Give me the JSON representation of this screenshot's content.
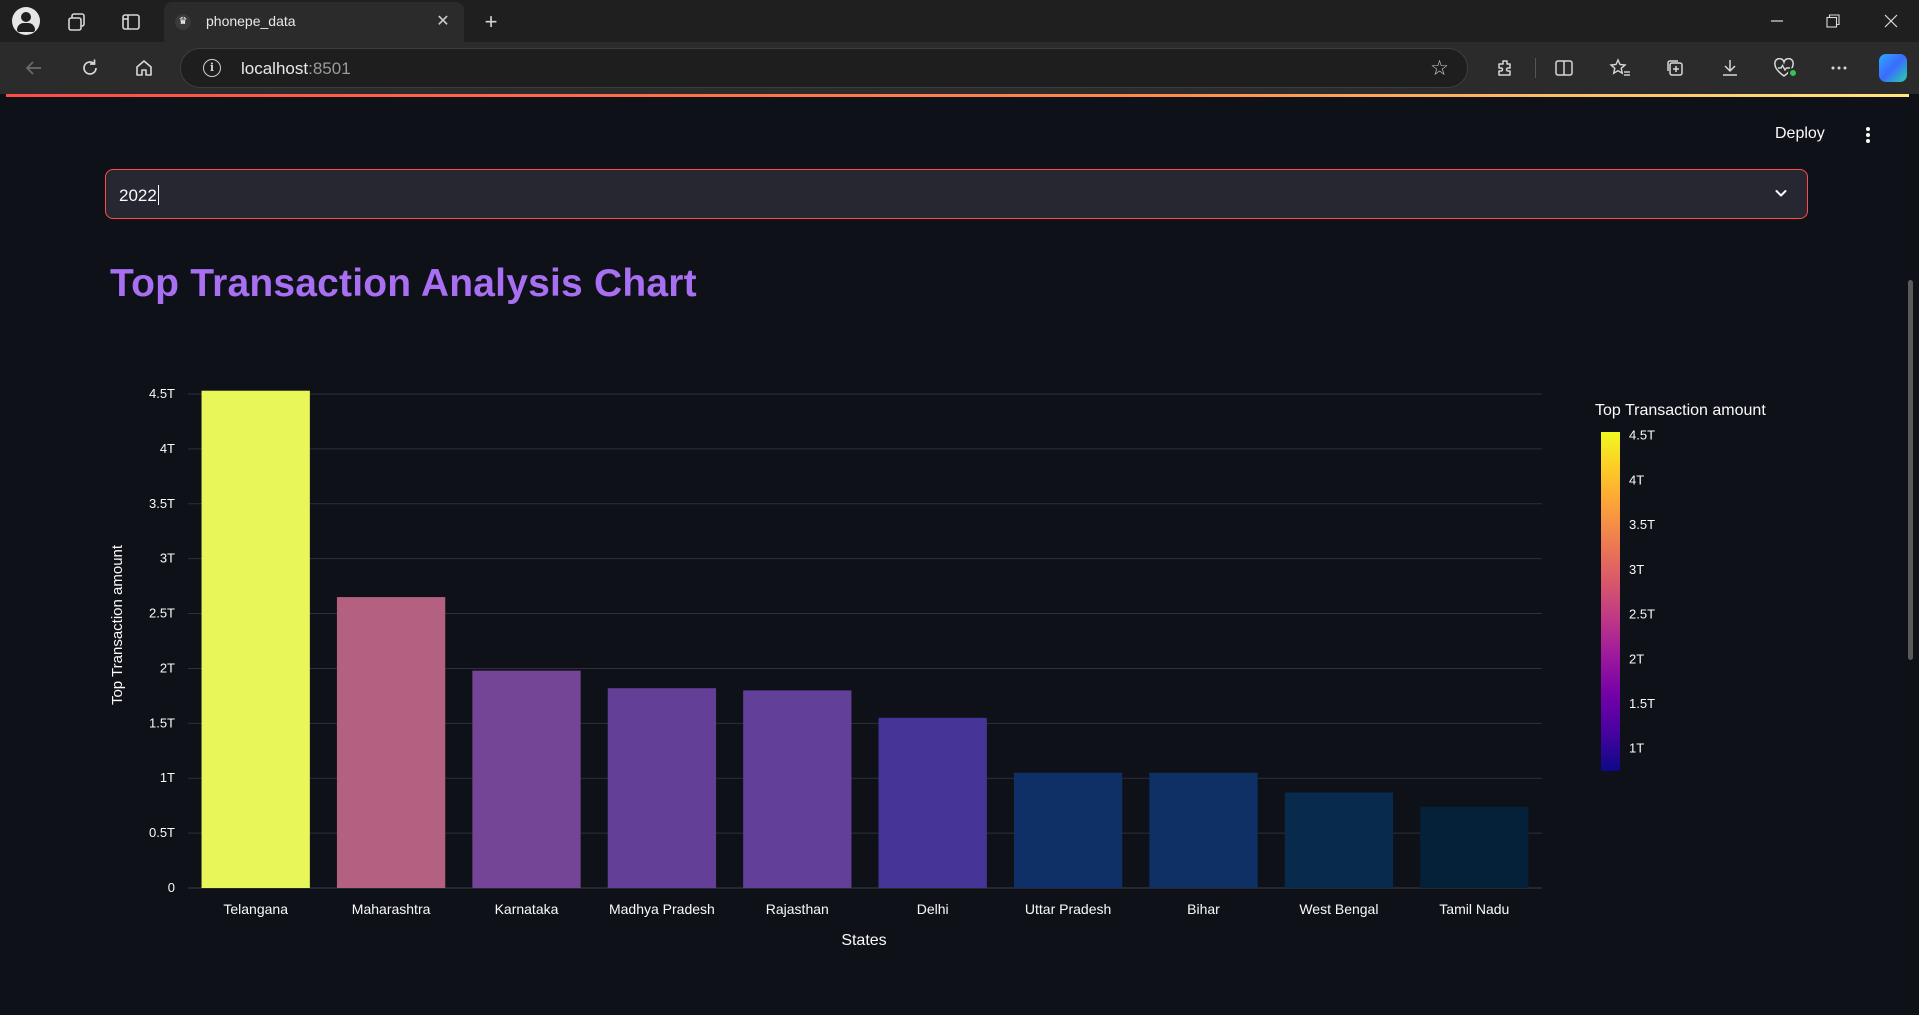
{
  "browser": {
    "tab_title": "phonepe_data",
    "favicon": "crown-icon",
    "url_host": "localhost",
    "url_port": ":8501"
  },
  "app": {
    "deploy_label": "Deploy",
    "year_select": {
      "value": "2022",
      "border_color": "#ff4b4b"
    },
    "chart_title": "Top Transaction Analysis Chart",
    "title_color": "#a86ff2"
  },
  "chart_data": {
    "type": "bar",
    "categories": [
      "Telangana",
      "Maharashtra",
      "Karnataka",
      "Madhya Pradesh",
      "Rajasthan",
      "Delhi",
      "Uttar Pradesh",
      "Bihar",
      "West Bengal",
      "Tamil Nadu"
    ],
    "values": [
      4.53,
      2.65,
      1.98,
      1.82,
      1.8,
      1.55,
      1.05,
      1.05,
      0.87,
      0.74
    ],
    "value_unit": "T",
    "xlabel": "States",
    "ylabel": "Top Transaction amount",
    "ylim": [
      0,
      4.55
    ],
    "yticks": [
      "0",
      "0.5T",
      "1T",
      "1.5T",
      "2T",
      "2.5T",
      "3T",
      "3.5T",
      "4T",
      "4.5T"
    ],
    "grid": true,
    "colorbar": {
      "title": "Top Transaction amount",
      "range": [
        0.74,
        4.53
      ],
      "ticks": [
        "1T",
        "1.5T",
        "2T",
        "2.5T",
        "3T",
        "3.5T",
        "4T",
        "4.5T"
      ],
      "colorscale": [
        "#0d0887",
        "#46039f",
        "#7201a8",
        "#9c179e",
        "#bd3786",
        "#d8576b",
        "#ed7953",
        "#fb9f3a",
        "#fdca26",
        "#f0f921"
      ],
      "placement": "right"
    },
    "bar_colors": [
      "#e8f65a",
      "#b36081",
      "#744597",
      "#643f97",
      "#623f98",
      "#463497",
      "#0f3066",
      "#0f3065",
      "#082a4d",
      "#05213a"
    ]
  }
}
